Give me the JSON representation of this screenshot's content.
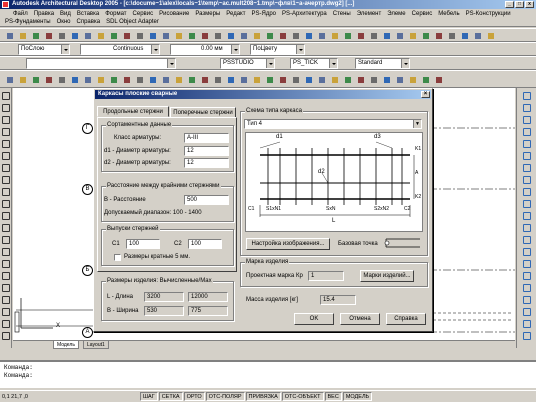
{
  "app": {
    "title": "Autodesk Architectural Desktop 2005 - [c:\\docume~1\\alex\\locals~1\\temp\\~ac.mult208~1.tmp\\~флв\\1~a-ачертр.dwg2] [...]"
  },
  "menu_row1": [
    "Файл",
    "Правка",
    "Вид",
    "Вставка",
    "Формат",
    "Сервис",
    "Рисование",
    "Размеры",
    "Редакт",
    "PS-Ядро",
    "PS-Архитектура",
    "Стены",
    "Элемент",
    "Элеме",
    "Сервис",
    "Мебель",
    "PS-Конструкции"
  ],
  "menu_row2": [
    "PS-Фундаменты",
    "Окно",
    "Справка",
    "SDL Object Adapter"
  ],
  "toolbar": {
    "layer_combo": "ПоСлою",
    "linetype_combo": "Continuous",
    "lineweight_combo": "0.00 мм",
    "color_combo": "ПоЦвету",
    "plotstyle_combo": "PSSTUDIO",
    "tick_combo": "PS_TICK",
    "dimstyle_combo": "Standard"
  },
  "drawing": {
    "bubbles": [
      "Г",
      "В",
      "Б",
      "А"
    ],
    "axis_label": "X"
  },
  "tabs_bottom": [
    "Модель",
    "Layout1"
  ],
  "command_lines": [
    "Команда:",
    "Команда:"
  ],
  "status": {
    "coords": "0,1  21,7 ,0",
    "toggles": [
      "ШАГ",
      "СЕТКА",
      "ОРТО",
      "ОТС-ПОЛЯР",
      "ПРИВЯЗКА",
      "ОТС-ОБЪЕКТ",
      "ВЕС",
      "МОДЕЛЬ"
    ]
  },
  "dialog": {
    "title": "Каркасы плоские сварные",
    "close": "×",
    "tabs": [
      "Продольные стержни",
      "Поперечные стержни"
    ],
    "assortment": {
      "title": "Сортаментные данные",
      "class_label": "Класс арматуры:",
      "class_value": "A-III",
      "d1_label": "d1 - Диаметр арматуры:",
      "d1_value": "12",
      "d2_label": "d2 - Диаметр арматуры:",
      "d2_value": "12"
    },
    "distance": {
      "title": "Расстояние между крайними стержнями",
      "b_label": "B - Расстояние",
      "b_value": "500",
      "range_text": "Допускаемый диапазон: 100 - 1400"
    },
    "outlets": {
      "title": "Выпуски стержней",
      "c1_label": "C1",
      "c1_value": "100",
      "c2_label": "C2",
      "c2_value": "100",
      "multiple_label": "Размеры кратные 5 мм."
    },
    "sizes": {
      "title": "Размеры изделия: Вычисленные/Мах",
      "l_label": "L - Длина",
      "l_value": "3200",
      "l_max": "12000",
      "b_label": "B - Ширина",
      "b_value": "530",
      "b_max": "775"
    },
    "scheme": {
      "title": "Схема типа каркаса",
      "type_value": "Тип 4",
      "labels": {
        "d1": "d1",
        "d2": "d2",
        "d3": "d3",
        "k1": "K1",
        "a": "A",
        "k2": "K2",
        "c1": "C1",
        "s1n1": "S1xN1",
        "sxn": "SxN",
        "s2n2": "S2xN2",
        "c2": "C2",
        "l": "L"
      }
    },
    "settings_button": "Настройка изображения...",
    "base_point_label": "Базовая точка",
    "marking": {
      "title": "Марка изделия",
      "project_label": "Проектная марка",
      "kr_label": "Кр",
      "kr_value": "1",
      "marks_button": "Марки изделий..."
    },
    "mass_label": "Масса изделия [кг]",
    "mass_value": "15.4",
    "ok_button": "OK",
    "cancel_button": "Отмена",
    "help_button": "Справка"
  }
}
